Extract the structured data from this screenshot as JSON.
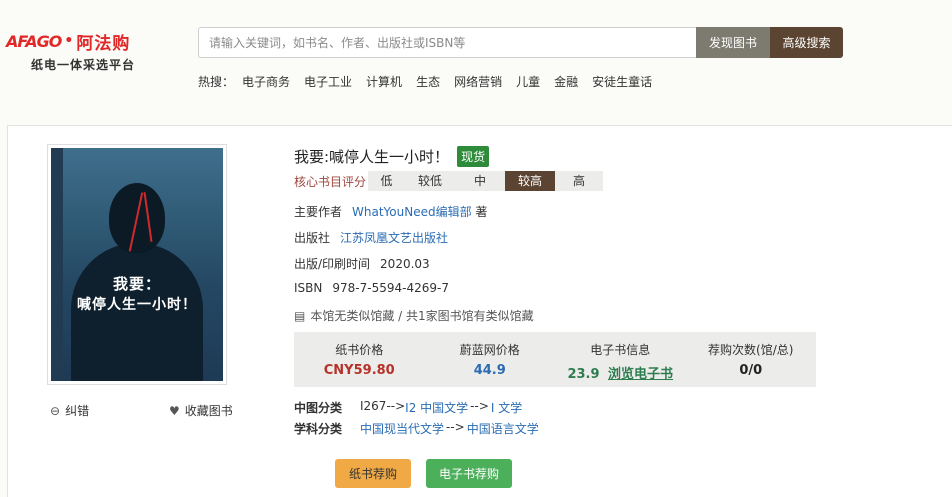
{
  "header": {
    "logo_mark": "AFAGO",
    "logo_cn": "阿法购",
    "logo_subtitle": "纸电一体采选平台",
    "search_placeholder": "请输入关键词，如书名、作者、出版社或ISBN等",
    "discover_button": "发现图书",
    "advanced_button": "高级搜索",
    "hot_label": "热搜：",
    "hot_terms": [
      "电子商务",
      "电子工业",
      "计算机",
      "生态",
      "网络营销",
      "儿童",
      "金融",
      "安徒生童话"
    ]
  },
  "book": {
    "cover_title_line1": "我要：",
    "cover_title_line2": "喊停人生一小时！",
    "title": "我要:喊停人生一小时！",
    "stock_badge": "现货",
    "rating_label": "核心书目评分",
    "rating_levels": [
      "低",
      "较低",
      "中",
      "较高",
      "高"
    ],
    "rating_selected": "较高",
    "author_label": "主要作者",
    "author": "WhatYouNeed编辑部",
    "author_suffix": "著",
    "publisher_label": "出版社",
    "publisher": "江苏凤凰文艺出版社",
    "date_label": "出版/印刷时间",
    "date": "2020.03",
    "isbn_label": "ISBN",
    "isbn": "978-7-5594-4269-7",
    "holdings_text": "本馆无类似馆藏 / 共1家图书馆有类似馆藏",
    "feedback_label": "纠错",
    "collect_label": "收藏图书"
  },
  "prices": {
    "paper_label": "纸书价格",
    "paper_value": "CNY59.80",
    "weilan_label": "蔚蓝网价格",
    "weilan_value": "44.9",
    "ebook_label": "电子书信息",
    "ebook_value": "23.9",
    "ebook_link": "浏览电子书",
    "recommend_label": "荐购次数(馆/总)",
    "recommend_value": "0/0"
  },
  "classification": {
    "clc_label": "中图分类",
    "clc_prefix": "I267-->",
    "clc_links": [
      "I2 中国文学",
      "I 文学"
    ],
    "clc_sep": "-->",
    "subject_label": "学科分类",
    "subject_links": [
      "中国现当代文学",
      "中国语言文学"
    ],
    "subject_sep": "-->"
  },
  "actions": {
    "paper_recommend": "纸书荐购",
    "ebook_recommend": "电子书荐购"
  },
  "colors": {
    "brand_red": "#e02828",
    "brown": "#5b4431",
    "stock_green": "#2e8b3a",
    "paper_btn": "#f0a944",
    "ebook_btn": "#4caf5a"
  }
}
